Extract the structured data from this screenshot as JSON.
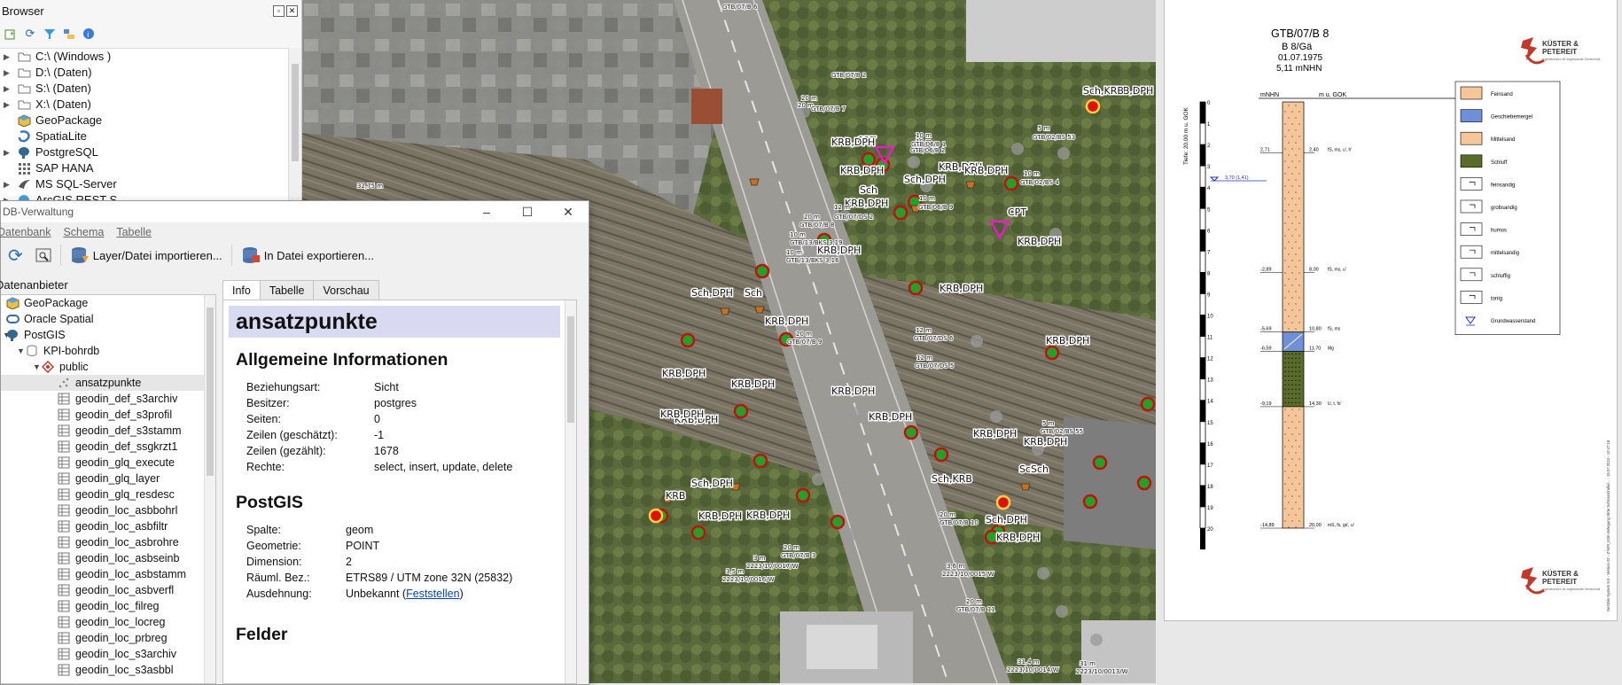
{
  "browser": {
    "title": "Browser",
    "items": [
      {
        "label": "C:\\ (Windows )",
        "icon": "folder-icon",
        "expandable": true
      },
      {
        "label": "D:\\ (Daten)",
        "icon": "folder-icon",
        "expandable": true
      },
      {
        "label": "S:\\ (Daten)",
        "icon": "folder-icon",
        "expandable": true
      },
      {
        "label": "X:\\ (Daten)",
        "icon": "folder-icon",
        "expandable": true
      },
      {
        "label": "GeoPackage",
        "icon": "geopackage-icon",
        "expandable": false
      },
      {
        "label": "SpatiaLite",
        "icon": "spatialite-icon",
        "expandable": false
      },
      {
        "label": "PostgreSQL",
        "icon": "postgresql-icon",
        "expandable": true
      },
      {
        "label": "SAP HANA",
        "icon": "saphana-icon",
        "expandable": false
      },
      {
        "label": "MS SQL-Server",
        "icon": "mssql-icon",
        "expandable": true
      },
      {
        "label": "ArcGIS REST S...",
        "icon": "arcgis-icon",
        "expandable": true
      }
    ]
  },
  "db": {
    "window_title": "DB-Verwaltung",
    "menu": [
      "Datenbank",
      "Schema",
      "Tabelle"
    ],
    "toolbar": {
      "import_label": "Layer/Datei importieren...",
      "export_label": "In Datei exportieren..."
    },
    "providers_header": "Datenanbieter",
    "providers": [
      {
        "label": "GeoPackage",
        "level": 0,
        "icon": "geopackage-icon",
        "arrow": ""
      },
      {
        "label": "Oracle Spatial",
        "level": 0,
        "icon": "oracle-icon",
        "arrow": ""
      },
      {
        "label": "PostGIS",
        "level": 0,
        "icon": "postgis-icon",
        "arrow": "open"
      },
      {
        "label": "KPI-bohrdb",
        "level": 1,
        "icon": "database-icon",
        "arrow": "open"
      },
      {
        "label": "public",
        "level": 2,
        "icon": "schema-icon",
        "arrow": "open"
      },
      {
        "label": "ansatzpunkte",
        "level": 3,
        "icon": "point-layer-icon",
        "arrow": "",
        "selected": true
      },
      {
        "label": "geodin_def_s3archiv",
        "level": 3,
        "icon": "table-icon",
        "arrow": ""
      },
      {
        "label": "geodin_def_s3profil",
        "level": 3,
        "icon": "table-icon",
        "arrow": ""
      },
      {
        "label": "geodin_def_s3stamm",
        "level": 3,
        "icon": "table-icon",
        "arrow": ""
      },
      {
        "label": "geodin_def_ssgkrzt1",
        "level": 3,
        "icon": "table-icon",
        "arrow": ""
      },
      {
        "label": "geodin_glq_execute",
        "level": 3,
        "icon": "table-icon",
        "arrow": ""
      },
      {
        "label": "geodin_glq_layer",
        "level": 3,
        "icon": "table-icon",
        "arrow": ""
      },
      {
        "label": "geodin_glq_resdesc",
        "level": 3,
        "icon": "table-icon",
        "arrow": ""
      },
      {
        "label": "geodin_loc_asbbohrl",
        "level": 3,
        "icon": "table-icon",
        "arrow": ""
      },
      {
        "label": "geodin_loc_asbfiltr",
        "level": 3,
        "icon": "table-icon",
        "arrow": ""
      },
      {
        "label": "geodin_loc_asbrohre",
        "level": 3,
        "icon": "table-icon",
        "arrow": ""
      },
      {
        "label": "geodin_loc_asbseinb",
        "level": 3,
        "icon": "table-icon",
        "arrow": ""
      },
      {
        "label": "geodin_loc_asbstamm",
        "level": 3,
        "icon": "table-icon",
        "arrow": ""
      },
      {
        "label": "geodin_loc_asbverfl",
        "level": 3,
        "icon": "table-icon",
        "arrow": ""
      },
      {
        "label": "geodin_loc_filreg",
        "level": 3,
        "icon": "table-icon",
        "arrow": ""
      },
      {
        "label": "geodin_loc_locreg",
        "level": 3,
        "icon": "table-icon",
        "arrow": ""
      },
      {
        "label": "geodin_loc_prbreg",
        "level": 3,
        "icon": "table-icon",
        "arrow": ""
      },
      {
        "label": "geodin_loc_s3archiv",
        "level": 3,
        "icon": "table-icon",
        "arrow": ""
      },
      {
        "label": "geodin_loc_s3asbbl",
        "level": 3,
        "icon": "table-icon",
        "arrow": ""
      }
    ],
    "tabs": [
      "Info",
      "Tabelle",
      "Vorschau"
    ],
    "active_tab": "Info",
    "info": {
      "title": "ansatzpunkte",
      "general_heading": "Allgemeine Informationen",
      "general": [
        {
          "key": "Beziehungsart:",
          "value": "Sicht"
        },
        {
          "key": "Besitzer:",
          "value": "postgres"
        },
        {
          "key": "Seiten:",
          "value": "0"
        },
        {
          "key": "Zeilen (geschätzt):",
          "value": "-1"
        },
        {
          "key": "Zeilen (gezählt):",
          "value": "1678"
        },
        {
          "key": "Rechte:",
          "value": "select, insert, update, delete"
        }
      ],
      "postgis_heading": "PostGIS",
      "postgis": [
        {
          "key": "Spalte:",
          "value": "geom"
        },
        {
          "key": "Geometrie:",
          "value": "POINT"
        },
        {
          "key": "Dimension:",
          "value": "2"
        },
        {
          "key": "Räuml. Bez.:",
          "value": "ETRS89 / UTM zone 32N (25832)"
        }
      ],
      "extent_key": "Ausdehnung:",
      "extent_value": "Unbekannt (",
      "extent_link": "Feststellen",
      "extent_close": ")",
      "fields_heading": "Felder"
    }
  },
  "map": {
    "labels": [
      "KRB,DPH",
      "Sch,KRB",
      "CPT",
      "KRB,DPH",
      "KRB,DPH",
      "Sch",
      "Sch,DPH",
      "KRB,DPH",
      "KRB,DPH",
      "KRB,DPH",
      "CPT",
      "KRB,DPH",
      "KRB,DPH",
      "KRB,DPH",
      "Sch,DPH",
      "Sch",
      "KRB,DPH",
      "KRB,DPH",
      "KRB,DPH",
      "KRB,DPH",
      "KRB,DPH",
      "KRB,DPH",
      "KRB,DPH",
      "KRB,DPH",
      "KRB,DPH",
      "Sch",
      "KRB,DPH",
      "Sch,DPH",
      "Sch,KRB",
      "Sch",
      "Sch,DPH",
      "KRB,DPH",
      "KRB,DPH",
      "KRB",
      "KRB,DPH"
    ],
    "small_labels": [
      "GTB/07/B 6",
      "20 m",
      "GTB/07/B 2",
      "20 m",
      "GTB/07/B 7",
      "10 m",
      "GTB/06/B 2",
      "10 m",
      "GTB/06/B 1",
      "5 m",
      "GTB/02/BS 53",
      "10 m",
      "GTB/02/BS 4",
      "32,75 m",
      "20 m",
      "GTB/07/B 8",
      "12 m",
      "GTB/07/DS 2",
      "10 m",
      "GTB/06/B 9",
      "10 m",
      "GTB/13/BKS 3,19",
      "10 m",
      "GTB/13/BKS 3,16",
      "2,2 m",
      "2223/13/DPH 3,18",
      "GTB/13/BKS 3,16",
      "BS 24",
      "20 m",
      "GTB/07/B 9",
      "12 m",
      "GTB/07/DS 6",
      "12 m",
      "GTB/07/DS 5",
      "5 m",
      "GTB/02/BS 55",
      "20 m",
      "GTB/07/B 10",
      "20 m",
      "GTB/07/B 3",
      "3 m",
      "2223/10/0017/W",
      "3,5 m",
      "2223/10/0016/W",
      "3,6 m",
      "2223/10/0015/W",
      "20 m",
      "GTB/07/B 11",
      "31,4 m",
      "2223/10/0014/W",
      "31 m",
      "2223/10/0013/W"
    ]
  },
  "report": {
    "borehole": "GTB/07/B 8",
    "subtitle": "B 8/Gä",
    "date": "01.07.1975",
    "elevation": "5,11 mNHN",
    "company_line1": "KÜSTER &",
    "company_line2": "PETEREIT",
    "company_sub": "Ingenieurbüro für angewandte Geotechnik",
    "col_mnhn": "mNHN",
    "col_mugok": "m u. GOK",
    "depth_axis_label": "Tiefe: 20,00 m u. GOK",
    "water_level": "3,70 (1,41)",
    "depth_ticks": [
      "0",
      "1",
      "2",
      "3",
      "4",
      "5",
      "6",
      "7",
      "8",
      "9",
      "10",
      "11",
      "12",
      "13",
      "14",
      "15",
      "16",
      "17",
      "18",
      "19",
      "20"
    ],
    "layers": [
      {
        "mnhn": "2,71",
        "depth": "2,40",
        "desc": "fS, ms, u', h'"
      },
      {
        "mnhn": "-2,89",
        "depth": "8,00",
        "desc": "fS, ms, u'"
      },
      {
        "mnhn": "-5,69",
        "depth": "10,80",
        "desc": "fS, ms"
      },
      {
        "mnhn": "-6,59",
        "depth": "11,70",
        "desc": "Mg"
      },
      {
        "mnhn": "-9,19",
        "depth": "14,30",
        "desc": "U, t, fs'"
      },
      {
        "mnhn": "-14,89",
        "depth": "20,00",
        "desc": "mS, fs, gs', u'"
      }
    ],
    "legend": [
      "Feinsand",
      "Geschiebemergel",
      "Mittelsand",
      "Schluff",
      "feinsandig",
      "grobsandig",
      "humos",
      "mittelsandig",
      "schluffig",
      "tonig",
      "Grundwasserstand"
    ],
    "side_text": "GeODin System 9.0 - Version 02 - Z:\\KPI_K39 Verlegung Mitte Schlossstraße\\... - 15.07.2024 - 12:47:18",
    "colors": {
      "sand": "#f5c69a",
      "marl": "#6f8fd8",
      "silt": "#5a6b2a",
      "water": "#2030c0"
    }
  }
}
